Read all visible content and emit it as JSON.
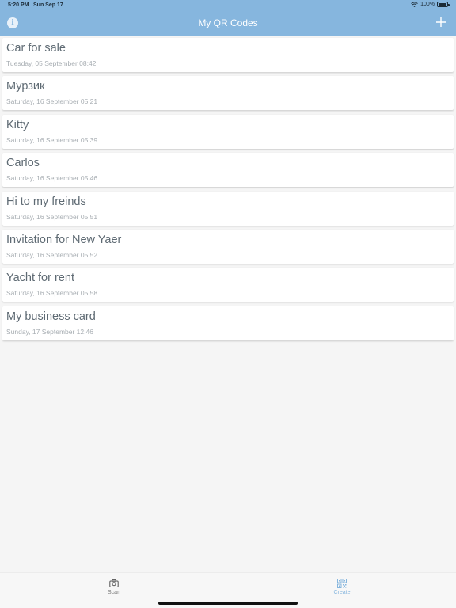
{
  "status": {
    "time": "5:20 PM",
    "date": "Sun Sep 17",
    "battery": "100%"
  },
  "header": {
    "title": "My QR Codes",
    "info_icon": "info-icon",
    "add_icon": "plus-icon"
  },
  "items": [
    {
      "title": "Car for sale",
      "date": "Tuesday, 05 September 08:42"
    },
    {
      "title": "Мурзик",
      "date": "Saturday, 16 September 05:21"
    },
    {
      "title": "Kitty",
      "date": "Saturday, 16 September 05:39"
    },
    {
      "title": "Carlos",
      "date": "Saturday, 16 September 05:46"
    },
    {
      "title": "Hi to my freinds",
      "date": "Saturday, 16 September 05:51"
    },
    {
      "title": "Invitation for New Yaer",
      "date": "Saturday, 16 September 05:52"
    },
    {
      "title": "Yacht for rent",
      "date": "Saturday, 16 September 05:58"
    },
    {
      "title": "My business card",
      "date": "Sunday, 17 September 12:46"
    }
  ],
  "tabbar": {
    "scan_label": "Scan",
    "create_label": "Create",
    "active_tab": "Create"
  },
  "colors": {
    "header": "#86b6de",
    "accent": "#86b6de",
    "background": "#f5f5f5"
  }
}
